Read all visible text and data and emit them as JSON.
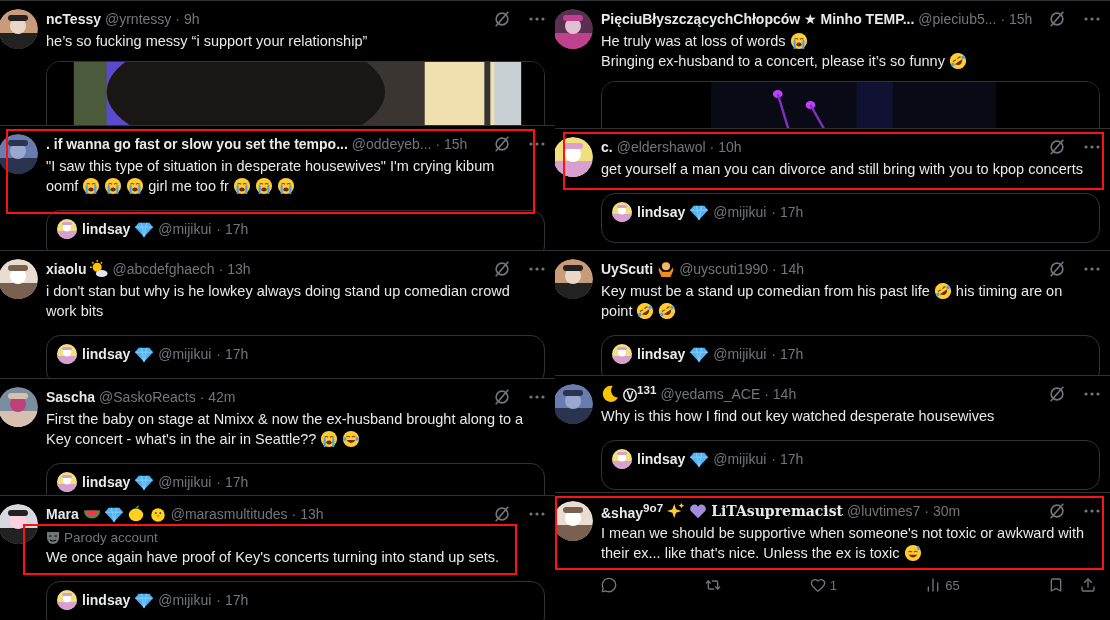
{
  "columns": [
    {
      "tweets": [
        {
          "name": [
            {
              "kind": "text",
              "text": "ncTessy"
            }
          ],
          "handle": "@yrntessy",
          "time": "· 9h",
          "body": [
            [
              {
                "kind": "text",
                "text": "he’s so fucking messy “i support your relationship”"
              }
            ]
          ],
          "media": {
            "kind": "picture"
          },
          "highlighted": false
        },
        {
          "name": [
            {
              "kind": "text",
              "text": ". if wanna go fast or slow you set the tempo..."
            }
          ],
          "handle": "@oddeyeb...",
          "time": "· 15h",
          "body": [
            [
              {
                "kind": "text",
                "text": "\"I saw this type of situation in desperate housewives\" I'm crying kibum"
              }
            ],
            [
              {
                "kind": "text",
                "text": "oomf"
              },
              {
                "kind": "cry"
              },
              {
                "kind": "cry"
              },
              {
                "kind": "cry"
              },
              {
                "kind": "text",
                "text": " girl me too fr"
              },
              {
                "kind": "cry"
              },
              {
                "kind": "cry"
              },
              {
                "kind": "cry"
              }
            ]
          ],
          "quote": {
            "name": "lindsay",
            "handle": "@mijikui",
            "time": "· 17h"
          },
          "highlighted": true
        },
        {
          "name": [
            {
              "kind": "text",
              "text": "xiaolu"
            },
            {
              "kind": "sun-cloud"
            }
          ],
          "handle": "@abcdefghaech",
          "time": "· 13h",
          "body": [
            [
              {
                "kind": "text",
                "text": "i don't stan but why is he lowkey always doing stand up comedian crowd"
              }
            ],
            [
              {
                "kind": "text",
                "text": "work bits"
              }
            ]
          ],
          "quote": {
            "name": "lindsay",
            "handle": "@mijikui",
            "time": "· 17h"
          },
          "highlighted": false
        },
        {
          "name": [
            {
              "kind": "text",
              "text": "Sascha"
            }
          ],
          "handle": "@SaskoReacts",
          "time": "· 42m",
          "body": [
            [
              {
                "kind": "text",
                "text": "First the baby on stage at Nmixx & now the ex-husband brought along to a"
              }
            ],
            [
              {
                "kind": "text",
                "text": "Key concert - what's in the air in Seattle??"
              },
              {
                "kind": "cry"
              },
              {
                "kind": "joy"
              }
            ]
          ],
          "quote": {
            "name": "lindsay",
            "handle": "@mijikui",
            "time": "· 17h"
          },
          "highlighted": false
        },
        {
          "name": [
            {
              "kind": "text",
              "text": "Mara"
            },
            {
              "kind": "melon"
            },
            {
              "kind": "gem"
            },
            {
              "kind": "lemon"
            },
            {
              "kind": "chick"
            }
          ],
          "handle": "@marasmultitudes",
          "time": "· 13h",
          "parody": "Parody account",
          "body": [
            [
              {
                "kind": "text",
                "text": "We once again have proof of Key's concerts turning into stand up sets."
              }
            ]
          ],
          "quote": {
            "name": "lindsay",
            "handle": "@mijikui",
            "time": "· 17h"
          },
          "highlighted": true
        }
      ]
    },
    {
      "tweets": [
        {
          "name": [
            {
              "kind": "text",
              "text": "PięciuBłyszczącychChłopców ★ Minho TEMP..."
            }
          ],
          "handle": "@pieciub5...",
          "time": "· 15h",
          "body": [
            [
              {
                "kind": "text",
                "text": "He truly was at loss of words"
              },
              {
                "kind": "cry"
              }
            ],
            [
              {
                "kind": "text",
                "text": "Bringing ex-husband to a concert, please it’s so funny"
              },
              {
                "kind": "rofl"
              }
            ]
          ],
          "media": {
            "kind": "picture"
          },
          "highlighted": false
        },
        {
          "name": [
            {
              "kind": "text",
              "text": "c."
            }
          ],
          "handle": "@eldershawol",
          "time": "· 10h",
          "body": [
            [
              {
                "kind": "text",
                "text": "get yourself a man you can divorce and still bring with you to kpop concerts"
              }
            ]
          ],
          "quote": {
            "name": "lindsay",
            "handle": "@mijikui",
            "time": "· 17h"
          },
          "highlighted": true
        },
        {
          "name": [
            {
              "kind": "text",
              "text": "UyScuti"
            },
            {
              "kind": "shrug"
            }
          ],
          "handle": "@uyscuti1990",
          "time": "· 14h",
          "body": [
            [
              {
                "kind": "text",
                "text": "Key must be a stand up comedian from his past life"
              },
              {
                "kind": "rofl"
              },
              {
                "kind": "text",
                "text": "his timing are on"
              }
            ],
            [
              {
                "kind": "text",
                "text": "point"
              },
              {
                "kind": "rofl"
              },
              {
                "kind": "rofl"
              }
            ]
          ],
          "quote": {
            "name": "lindsay",
            "handle": "@mijikui",
            "time": "· 17h"
          },
          "highlighted": false
        },
        {
          "name": [
            {
              "kind": "moon"
            },
            {
              "kind": "text",
              "text": "Ⓥ$^{131}$"
            }
          ],
          "handle": "@yedams_ACE",
          "time": "· 14h",
          "body": [
            [
              {
                "kind": "text",
                "text": "Why is this how I find out key watched desperate housewives"
              }
            ]
          ],
          "quote": {
            "name": "lindsay",
            "handle": "@mijikui",
            "time": "· 17h"
          },
          "highlighted": false
        },
        {
          "name": [
            {
              "kind": "text",
              "text": "&shay$^{9o7}$"
            },
            {
              "kind": "sparkles"
            },
            {
              "kind": "heart"
            },
            {
              "kind": "fancy",
              "text": "LiTAsupremacist"
            }
          ],
          "handle": "@luvtimes7",
          "time": "· 30m",
          "body": [
            [
              {
                "kind": "text",
                "text": "I mean we should be supportive when someone's not toxic or awkward with"
              }
            ],
            [
              {
                "kind": "text",
                "text": "their ex... like that's nice. Unless the ex is toxic"
              },
              {
                "kind": "sweat"
              }
            ]
          ],
          "actions": {
            "likes": "1",
            "views": "65"
          },
          "highlighted": true
        }
      ]
    }
  ]
}
